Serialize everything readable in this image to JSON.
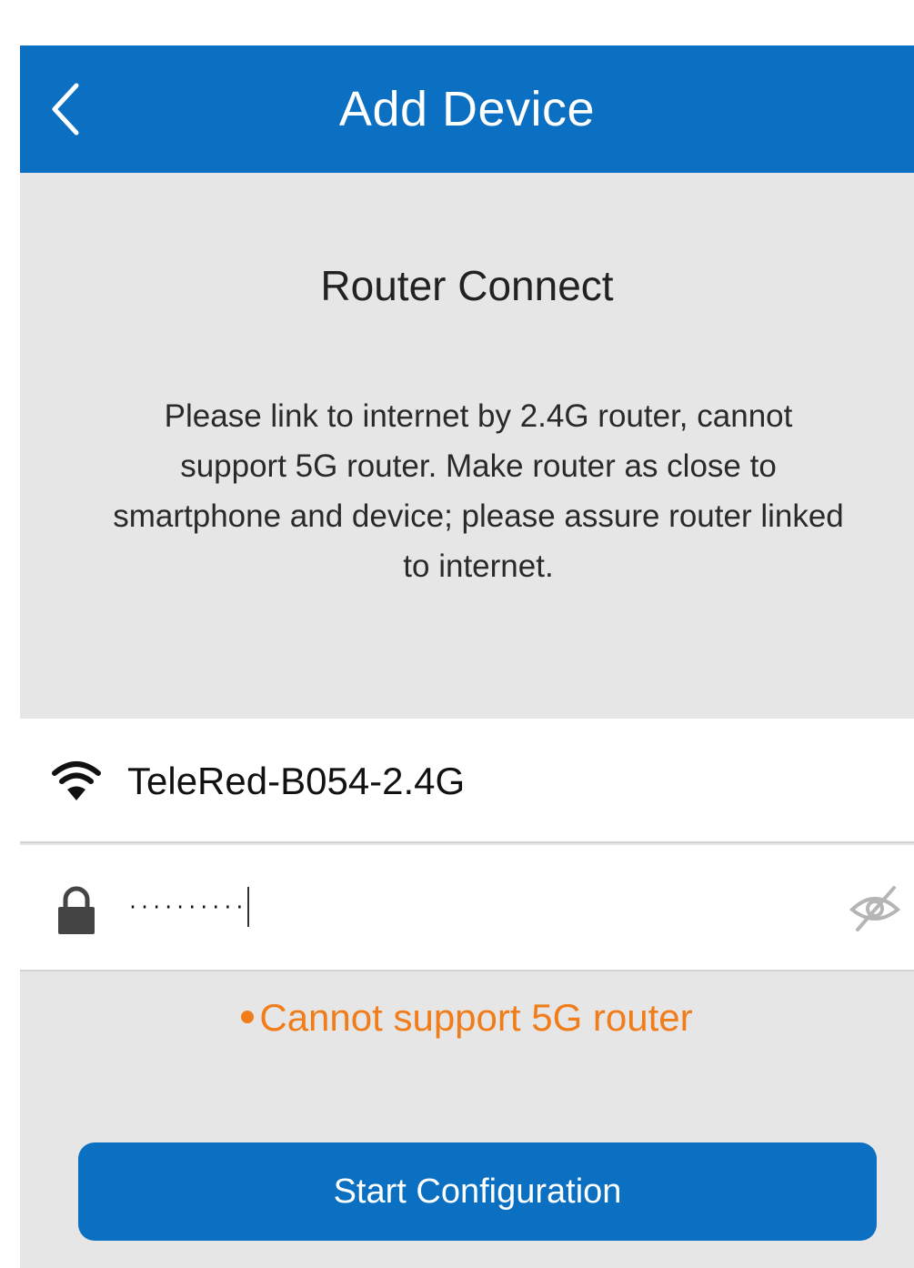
{
  "header": {
    "title": "Add Device",
    "back_icon": "chevron-left-icon"
  },
  "info": {
    "title": "Router Connect",
    "description": "Please link to internet by 2.4G router, cannot support 5G router. Make router as close to smartphone and device; please assure router linked to internet."
  },
  "wifi": {
    "icon": "wifi-icon",
    "ssid": "TeleRed-B054-2.4G"
  },
  "password": {
    "icon": "lock-icon",
    "value_masked": "··········",
    "visibility_icon": "eye-off-icon"
  },
  "warning": {
    "text": "Cannot support 5G router",
    "color": "#f07d1a"
  },
  "actions": {
    "start_label": "Start Configuration"
  },
  "colors": {
    "primary": "#0b6fc2",
    "panel_bg": "#e6e6e6",
    "field_bg": "#ffffff"
  }
}
